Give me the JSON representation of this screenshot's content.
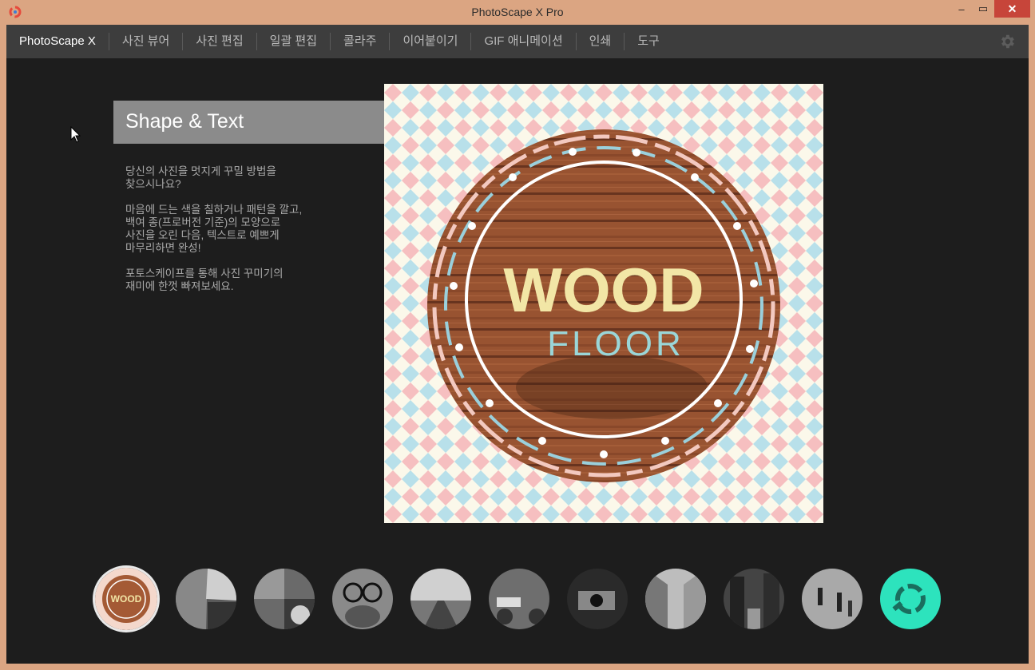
{
  "window": {
    "title": "PhotoScape X Pro",
    "minimize_label": "–",
    "maximize_label": "▭",
    "close_label": "✕"
  },
  "menu": {
    "items": [
      {
        "label": "PhotoScape X"
      },
      {
        "label": "사진 뷰어"
      },
      {
        "label": "사진 편집"
      },
      {
        "label": "일괄 편집"
      },
      {
        "label": "콜라주"
      },
      {
        "label": "이어붙이기"
      },
      {
        "label": "GIF 애니메이션"
      },
      {
        "label": "인쇄"
      },
      {
        "label": "도구"
      }
    ],
    "settings_icon": "gear-icon"
  },
  "feature": {
    "title": "Shape & Text",
    "paragraphs": [
      "당신의 사진을 멋지게 꾸밀 방법을\n찾으시나요?",
      "마음에 드는 색을 칠하거나 패턴을 깔고,\n백여 종(프로버전 기준)의 모양으로\n사진을 오린 다음, 텍스트로 예쁘게\n마무리하면 완성!",
      "포토스케이프를 통해 사진 꾸미기의\n재미에 한껏 빠져보세요."
    ]
  },
  "preview": {
    "logo_line1": "WOOD",
    "logo_line2": "FLOOR"
  },
  "thumbnails": {
    "count": 11,
    "selected_index": 0,
    "colors": {
      "accent": "#2de3bd",
      "pattern_pink": "#f6bfc0",
      "pattern_blue": "#b8e0ea",
      "pattern_cream": "#fbf8ea"
    }
  },
  "thumb_alts": [
    "wood floor design",
    "collage",
    "coffee collage",
    "glasses portrait",
    "road",
    "vintage car",
    "camera hands",
    "street",
    "city street",
    "people walking",
    "photoscape logo"
  ]
}
